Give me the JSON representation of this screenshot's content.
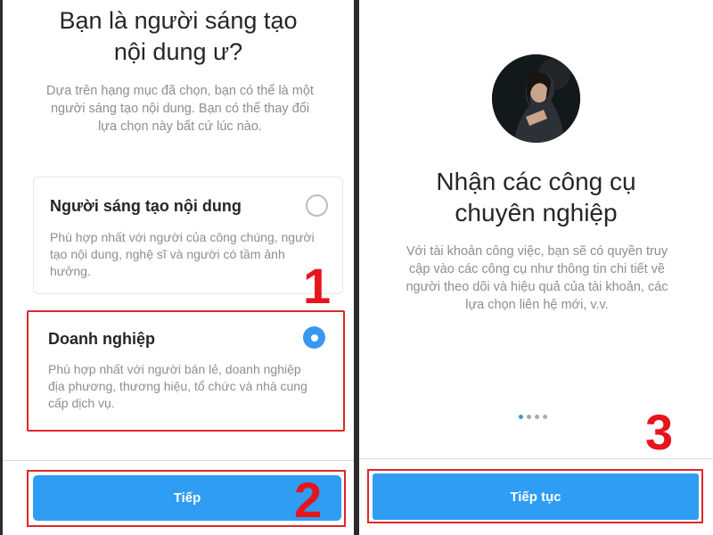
{
  "left_screen": {
    "title_line1": "Bạn là người sáng tạo",
    "title_line2": "nội dung ư?",
    "subtitle_line1": "Dựa trên hạng mục đã chọn, bạn có thể là một",
    "subtitle_line2": "người sáng tạo nội dung. Bạn có thể thay đổi",
    "subtitle_line3": "lựa chọn này bất cứ lúc nào.",
    "options": [
      {
        "title": "Người sáng tạo nội dung",
        "desc_line1": "Phù hợp nhất với người của công chúng, người",
        "desc_line2": "tạo nội dung, nghệ sĩ và người có tầm ảnh",
        "desc_line3": "hưởng.",
        "selected": false
      },
      {
        "title": "Doanh nghiệp",
        "desc_line1": "Phù hợp nhất với người bán lẻ, doanh nghiệp",
        "desc_line2": "địa phương, thương hiệu, tổ chức và nhà cung",
        "desc_line3": "cấp dịch vụ.",
        "selected": true
      }
    ],
    "next_button": "Tiếp"
  },
  "right_screen": {
    "title_line1": "Nhận các công cụ",
    "title_line2": "chuyên nghiệp",
    "desc_line1": "Với tài khoản công việc, bạn sẽ có quyền truy",
    "desc_line2": "cập vào các công cụ như thông tin chi tiết về",
    "desc_line3": "người theo dõi và hiệu quả của tài khoản, các",
    "desc_line4": "lựa chọn liên hệ mới, v.v.",
    "page_indicator": {
      "count": 4,
      "active": 1
    },
    "continue_button": "Tiếp tục"
  },
  "annotations": {
    "step1": "1",
    "step2": "2",
    "step3": "3"
  },
  "colors": {
    "accent_blue": "#2f9df3",
    "radio_selected": "#3897f0",
    "highlight_red": "#e0262a",
    "secondary_text": "#8e8e8e"
  }
}
